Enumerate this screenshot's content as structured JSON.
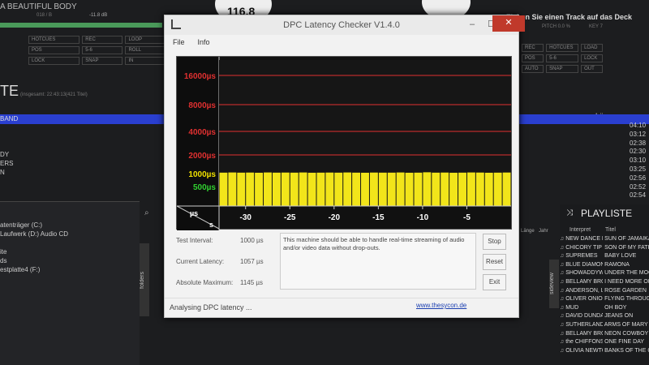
{
  "background_app": {
    "track_title": "A BEAUTIFUL BODY",
    "left_meta": "018 / B",
    "gain": "-11.8 dB",
    "bpm_display": "116.8",
    "drag_hint": "Ziehen Sie einen Track auf das Deck",
    "pitch": "PITCH 0.0 %",
    "key": "KEY 7",
    "left_controls": [
      "HOTCUES",
      "POS",
      "LOCK",
      "SNAP",
      "REC",
      "LOOP",
      "5-6",
      "ROLL",
      "IN"
    ],
    "right_controls": [
      "REC",
      "LOAD",
      "5-6",
      "AUTO",
      "OUT",
      "HOTCUES",
      "POS",
      "LOCK",
      "SNAP"
    ],
    "section_title": "TE",
    "section_meta": "(insgesamt: 22:43:13(421 Titel)",
    "selected_row": "BAND",
    "left_rows": [
      "DY",
      "ERS",
      "N"
    ],
    "length_header": "Länge",
    "lengths": [
      "04:10",
      "03:12",
      "02:38",
      "02:30",
      "03:10",
      "03:25",
      "02:56",
      "02:52",
      "02:54"
    ],
    "drives": [
      "atenträger (C:)",
      "Laufwerk (D:) Audio CD",
      "ite",
      "ds",
      "estplatte4 (F:)"
    ],
    "folders_tab": "folders",
    "sideview_tab": "sideview",
    "mid_headers": [
      "Länge",
      "Jahr"
    ],
    "playlist": {
      "title": "PLAYLISTE",
      "headers": [
        "Interpret",
        "Titel"
      ],
      "rows": [
        [
          "NEW DANCE BAND",
          "SUN OF JAMAIKA"
        ],
        [
          "CHICORY TIP",
          "SON OF MY FATHER"
        ],
        [
          "SUPREMES",
          "BABY LOVE"
        ],
        [
          "BLUE DIAMONDS",
          "RAMONA"
        ],
        [
          "SHOWADDYWAD...",
          "UNDER THE MOO..."
        ],
        [
          "BELLAMY BROTH...",
          "I NEED MORE OF"
        ],
        [
          "ANDERSON, LYNN",
          "ROSE GARDEN"
        ],
        [
          "OLIVER ONIONS",
          "FLYING THROUGH"
        ],
        [
          "MUD",
          "OH BOY"
        ],
        [
          "DAVID DUNDAS",
          "JEANS ON"
        ],
        [
          "SUTHERLAND BR...",
          "ARMS OF MARY"
        ],
        [
          "BELLAMY BROTH...",
          "NEON COWBOY"
        ],
        [
          "the CHIFFONS",
          "ONE FINE DAY"
        ],
        [
          "OLIVIA NEWTON...",
          "BANKS OF THE OH"
        ]
      ]
    }
  },
  "window": {
    "title": "DPC Latency Checker V1.4.0",
    "menu": [
      "File",
      "Info"
    ],
    "controls": {
      "minimize": "–",
      "maximize": "☐",
      "close": "✕"
    },
    "stats": [
      {
        "label": "Test Interval:",
        "value": "1000 µs"
      },
      {
        "label": "Current Latency:",
        "value": "1057 µs"
      },
      {
        "label": "Absolute Maximum:",
        "value": "1145 µs"
      }
    ],
    "message": "This machine should be able to handle real-time streaming of audio and/or video data without drop-outs.",
    "buttons": [
      "Stop",
      "Reset",
      "Exit"
    ],
    "status": "Analysing DPC latency ...",
    "link": "www.thesycon.de"
  },
  "chart_data": {
    "type": "bar",
    "y_unit_label": "µs",
    "x_unit_label": "s",
    "y_ticks": [
      {
        "value": 16000,
        "label": "16000µs",
        "color": "#e03030"
      },
      {
        "value": 8000,
        "label": "8000µs",
        "color": "#e03030"
      },
      {
        "value": 4000,
        "label": "4000µs",
        "color": "#e03030"
      },
      {
        "value": 2000,
        "label": "2000µs",
        "color": "#e03030"
      },
      {
        "value": 1000,
        "label": "1000µs",
        "color": "#f0e000"
      },
      {
        "value": 500,
        "label": "500µs",
        "color": "#30d030"
      }
    ],
    "x_ticks": [
      -30,
      -25,
      -20,
      -15,
      -10,
      -5
    ],
    "x_range": [
      -33,
      0
    ],
    "bar_color": "#f2e51a",
    "values": [
      1050,
      1060,
      1050,
      1055,
      1045,
      1060,
      1050,
      1055,
      1050,
      1060,
      1045,
      1050,
      1055,
      1050,
      1060,
      1050,
      1045,
      1055,
      1050,
      1050,
      1060,
      1045,
      1050,
      1070,
      1050,
      1055,
      1045,
      1050,
      1060,
      1055,
      1045,
      1050,
      1057
    ]
  }
}
